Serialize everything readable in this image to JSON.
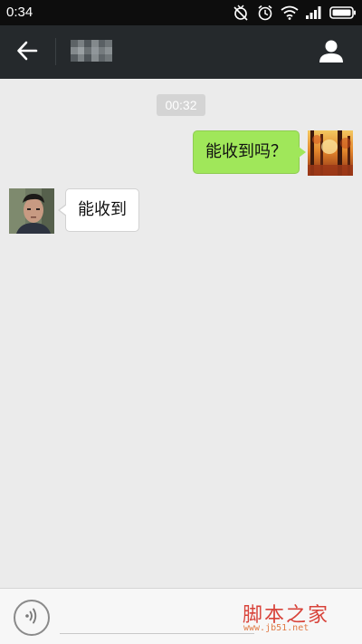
{
  "status_bar": {
    "time": "0:34",
    "icons": [
      "alarm-off-icon",
      "alarm-clock-icon",
      "wifi-icon",
      "signal-icon",
      "battery-icon"
    ]
  },
  "header": {
    "back_icon": "arrow-left-icon",
    "contact_name": "",
    "profile_icon": "person-icon",
    "background": "#25292c"
  },
  "chat": {
    "timestamp": "00:32",
    "messages": [
      {
        "sender": "self",
        "text": "能收到吗？",
        "bubble_color": "#a0e75a"
      },
      {
        "sender": "other",
        "text": "能收到",
        "bubble_color": "#ffffff"
      }
    ]
  },
  "input_bar": {
    "voice_icon": "voice-input-icon"
  },
  "watermark": {
    "title": "脚本之家",
    "url": "www.jb51.net"
  }
}
